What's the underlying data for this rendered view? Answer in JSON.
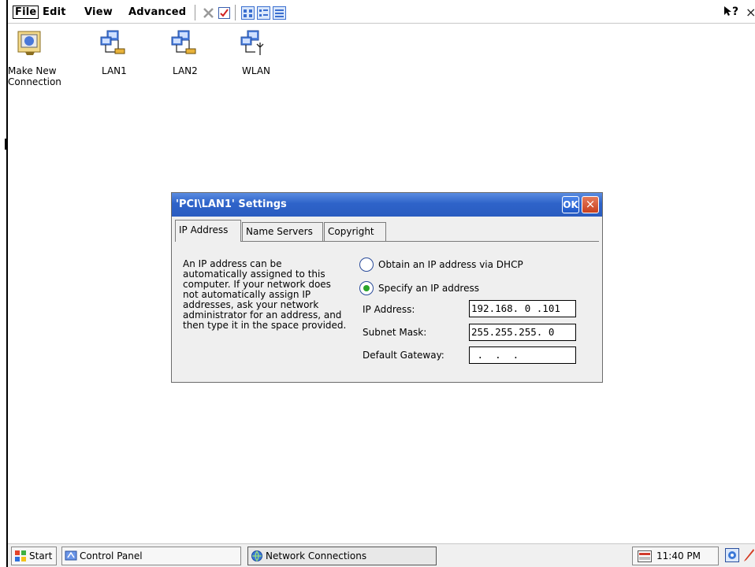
{
  "menubar": {
    "menus": [
      "File",
      "Edit",
      "View",
      "Advanced"
    ],
    "help_label": "?",
    "close_label": "×"
  },
  "desktop": {
    "icons": [
      {
        "label_line1": "Make New",
        "label_line2": "Connection",
        "icon": "make-connection-icon"
      },
      {
        "label_line1": "LAN1",
        "icon": "network-lan-icon"
      },
      {
        "label_line1": "LAN2",
        "icon": "network-lan-icon"
      },
      {
        "label_line1": "WLAN",
        "icon": "network-wlan-icon"
      }
    ]
  },
  "dialog": {
    "title": "'PCI\\LAN1' Settings",
    "ok_label": "OK",
    "close_label": "×",
    "tabs": [
      "IP Address",
      "Name Servers",
      "Copyright"
    ],
    "active_tab": "IP Address",
    "description": "An IP address can be automatically assigned to this computer.  If your network does not automatically assign IP addresses, ask your network administrator for an address, and then type it in the space provided.",
    "radio_dhcp": "Obtain an IP address via DHCP",
    "radio_specify": "Specify an IP address",
    "selected_radio": "specify",
    "ip_label": "IP Address:",
    "ip_value": "192.168. 0 .101",
    "subnet_label": "Subnet Mask:",
    "subnet_value": "255.255.255. 0",
    "gateway_label": "Default Gateway:",
    "gateway_value": " .  .  ."
  },
  "taskbar": {
    "start_label": "Start",
    "control_panel_label": "Control Panel",
    "network_label": "Network Connections",
    "clock": "11:40 PM"
  },
  "colors": {
    "title_bar": "#2e63c9",
    "radio_dot": "#2aa52a",
    "close_button": "#c8401f"
  }
}
